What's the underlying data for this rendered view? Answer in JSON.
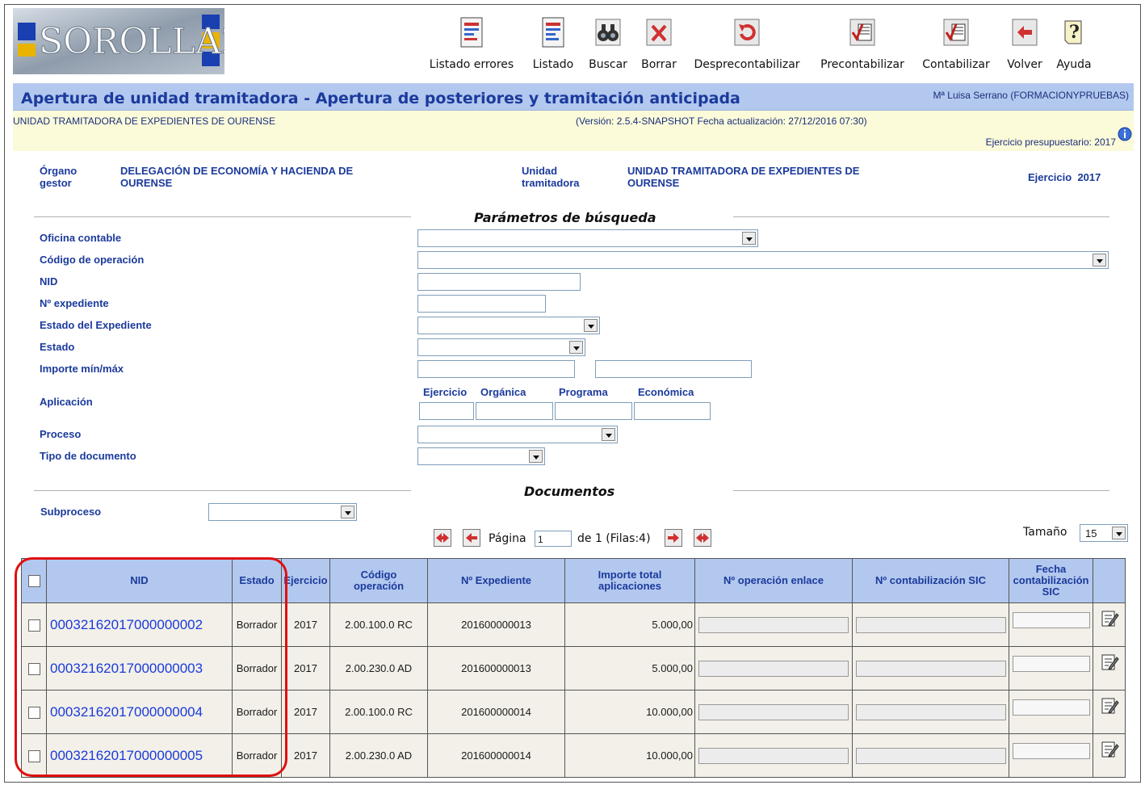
{
  "app": {
    "logo_text": "SOROLLA2"
  },
  "toolbar": [
    {
      "id": "listado-errores",
      "label": "Listado errores",
      "icon": "error-report-icon"
    },
    {
      "id": "listado",
      "label": "Listado",
      "icon": "report-icon"
    },
    {
      "id": "buscar",
      "label": "Buscar",
      "icon": "binoculars-icon"
    },
    {
      "id": "borrar",
      "label": "Borrar",
      "icon": "delete-icon"
    },
    {
      "id": "desprecontabilizar",
      "label": "Desprecontabilizar",
      "icon": "undo-icon"
    },
    {
      "id": "precontabilizar",
      "label": "Precontabilizar",
      "icon": "ledger-check-icon"
    },
    {
      "id": "contabilizar",
      "label": "Contabilizar",
      "icon": "ledger-check-icon"
    },
    {
      "id": "volver",
      "label": "Volver",
      "icon": "back-arrow-icon"
    },
    {
      "id": "ayuda",
      "label": "Ayuda",
      "icon": "help-icon"
    }
  ],
  "header": {
    "title": "Apertura de unidad tramitadora - Apertura de posteriores y tramitación anticipada",
    "user": "Mª Luisa Serrano (FORMACIONYPRUEBAS)",
    "unit": "UNIDAD TRAMITADORA DE EXPEDIENTES DE OURENSE",
    "version": "(Versión: 2.5.4-SNAPSHOT Fecha actualización: 27/12/2016 07:30)",
    "ejercicio_presupuestario": "Ejercicio presupuestario: 2017"
  },
  "context": {
    "organo_label_1": "Órgano",
    "organo_label_2": "gestor",
    "organo_value_1": "DELEGACIÓN DE ECONOMÍA Y HACIENDA DE",
    "organo_value_2": "OURENSE",
    "unidad_label_1": "Unidad",
    "unidad_label_2": "tramitadora",
    "unidad_value_1": "UNIDAD TRAMITADORA DE EXPEDIENTES DE",
    "unidad_value_2": "OURENSE",
    "ejercicio_label": "Ejercicio",
    "ejercicio_value": "2017"
  },
  "search": {
    "title": "Parámetros de búsqueda",
    "oficina": "Oficina contable",
    "codigo": "Código de operación",
    "nid": "NID",
    "expediente": "Nº expediente",
    "estado_exp": "Estado del Expediente",
    "estado": "Estado",
    "importe": "Importe mín/máx",
    "aplicacion": "Aplicación",
    "ap_ejercicio": "Ejercicio",
    "ap_organica": "Orgánica",
    "ap_programa": "Programa",
    "ap_economica": "Económica",
    "proceso": "Proceso",
    "tipo_doc": "Tipo de documento"
  },
  "documents": {
    "title": "Documentos",
    "subproceso": "Subproceso",
    "pagina_label": "Página",
    "pagina_value": "1",
    "pagina_total": "de 1 (Filas:4)",
    "tamano_label": "Tamaño",
    "tamano_value": "15"
  },
  "table": {
    "headers": {
      "nid": "NID",
      "estado": "Estado",
      "ejercicio": "Ejercicio",
      "codigo_1": "Código",
      "codigo_2": "operación",
      "expediente": "Nº Expediente",
      "importe_1": "Importe total",
      "importe_2": "aplicaciones",
      "op_enlace": "Nº operación enlace",
      "contab_sic": "Nº contabilización SIC",
      "fecha_1": "Fecha",
      "fecha_2": "contabilización",
      "fecha_3": "SIC"
    },
    "rows": [
      {
        "nid": "00032162017000000002",
        "estado": "Borrador",
        "ejercicio": "2017",
        "codigo": "2.00.100.0 RC",
        "expediente": "201600000013",
        "importe": "5.000,00"
      },
      {
        "nid": "00032162017000000003",
        "estado": "Borrador",
        "ejercicio": "2017",
        "codigo": "2.00.230.0 AD",
        "expediente": "201600000013",
        "importe": "5.000,00"
      },
      {
        "nid": "00032162017000000004",
        "estado": "Borrador",
        "ejercicio": "2017",
        "codigo": "2.00.100.0 RC",
        "expediente": "201600000014",
        "importe": "10.000,00"
      },
      {
        "nid": "00032162017000000005",
        "estado": "Borrador",
        "ejercicio": "2017",
        "codigo": "2.00.230.0 AD",
        "expediente": "201600000014",
        "importe": "10.000,00"
      }
    ]
  },
  "colors": {
    "header_blue": "#b3c8ee",
    "title_blue": "#1b3a9c",
    "link_blue": "#1b3adb",
    "info_yellow": "#fbfbd9",
    "highlight_red": "#e01010"
  }
}
